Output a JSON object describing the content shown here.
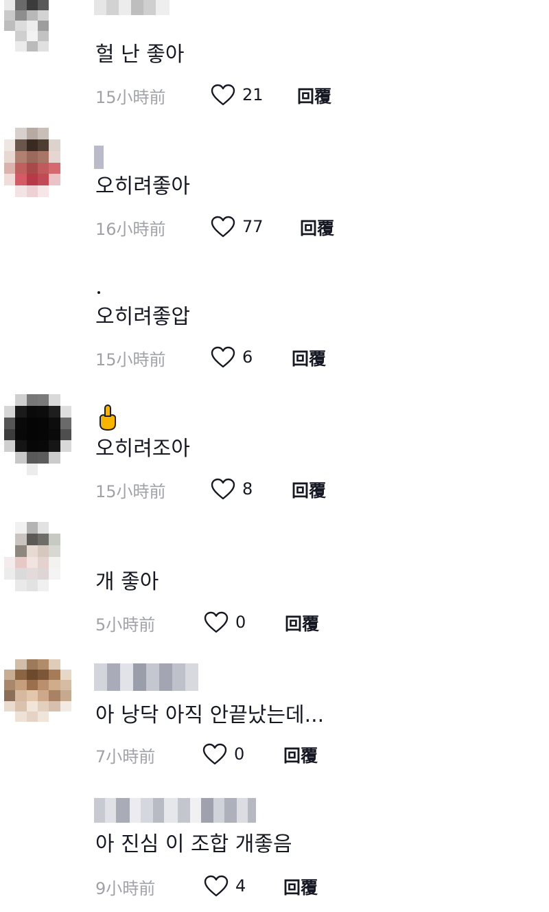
{
  "comments": [
    {
      "text": "헐 난 좋아",
      "time": "15小時前",
      "likes": "21",
      "reply_label": "回覆",
      "like_icon": "heart-outline-icon"
    },
    {
      "text": "오히려좋아",
      "time": "16小時前",
      "likes": "77",
      "reply_label": "回覆",
      "like_icon": "heart-outline-icon"
    },
    {
      "text": "오히려좋압",
      "time": "15小時前",
      "likes": "6",
      "reply_label": "回覆",
      "like_icon": "heart-outline-icon"
    },
    {
      "text": "오히려조아",
      "time": "15小時前",
      "likes": "8",
      "reply_label": "回覆",
      "like_icon": "heart-outline-icon",
      "username_emoji": "middle-finger-emoji"
    },
    {
      "text": "개 좋아",
      "time": "5小時前",
      "likes": "0",
      "reply_label": "回覆",
      "like_icon": "heart-outline-icon"
    },
    {
      "text": "아 낭닥 아직 안끝났는데...",
      "time": "7小時前",
      "likes": "0",
      "reply_label": "回覆",
      "like_icon": "heart-outline-icon"
    },
    {
      "text": "아 진심 이 조합 개좋음",
      "time": "9小時前",
      "likes": "4",
      "reply_label": "回覆",
      "like_icon": "heart-outline-icon"
    }
  ],
  "colors": {
    "text_primary": "#161823",
    "text_secondary": "#a1a2a7",
    "background": "#ffffff"
  }
}
